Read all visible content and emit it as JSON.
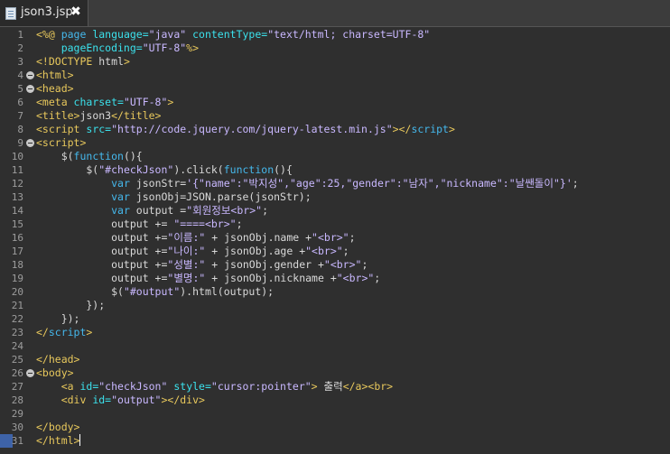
{
  "tab": {
    "title": "json3.jsp",
    "close": "✖"
  },
  "colors": {
    "tag": "#e8c85c",
    "attr": "#3be1ec",
    "string": "#c9b8ff",
    "keyword": "#45b8ec",
    "text": "#d9d9d9",
    "background": "#2f2f2f"
  },
  "lines": [
    {
      "n": "1",
      "fold": false,
      "segs": [
        [
          "<%@ ",
          "#e8c85c"
        ],
        [
          "page ",
          "#45b8ec"
        ],
        [
          "language=",
          "#3be1ec"
        ],
        [
          "\"java\"",
          "#c9b8ff"
        ],
        [
          " contentType=",
          "#3be1ec"
        ],
        [
          "\"text/html; charset=UTF-8\"",
          "#c9b8ff"
        ]
      ]
    },
    {
      "n": "2",
      "fold": false,
      "segs": [
        [
          "    pageEncoding=",
          "#3be1ec"
        ],
        [
          "\"UTF-8\"",
          "#c9b8ff"
        ],
        [
          "%>",
          "#e8c85c"
        ]
      ]
    },
    {
      "n": "3",
      "fold": false,
      "segs": [
        [
          "<!DOCTYPE ",
          "#e8c85c"
        ],
        [
          "html",
          "#d9d9d9"
        ],
        [
          ">",
          "#e8c85c"
        ]
      ]
    },
    {
      "n": "4",
      "fold": true,
      "segs": [
        [
          "<html>",
          "#e8c85c"
        ]
      ]
    },
    {
      "n": "5",
      "fold": true,
      "segs": [
        [
          "<head>",
          "#e8c85c"
        ]
      ]
    },
    {
      "n": "6",
      "fold": false,
      "segs": [
        [
          "<meta ",
          "#e8c85c"
        ],
        [
          "charset=",
          "#3be1ec"
        ],
        [
          "\"UTF-8\"",
          "#c9b8ff"
        ],
        [
          ">",
          "#e8c85c"
        ]
      ]
    },
    {
      "n": "7",
      "fold": false,
      "segs": [
        [
          "<title>",
          "#e8c85c"
        ],
        [
          "json3",
          "#d9d9d9"
        ],
        [
          "</title>",
          "#e8c85c"
        ]
      ]
    },
    {
      "n": "8",
      "fold": false,
      "segs": [
        [
          "<script ",
          "#e8c85c"
        ],
        [
          "src=",
          "#3be1ec"
        ],
        [
          "\"http://code.jquery.com/jquery-latest.min.js\"",
          "#c9b8ff"
        ],
        [
          "></",
          "#e8c85c"
        ],
        [
          "script",
          "#45b8ec"
        ],
        [
          ">",
          "#e8c85c"
        ]
      ]
    },
    {
      "n": "9",
      "fold": true,
      "segs": [
        [
          "<script>",
          "#e8c85c"
        ]
      ]
    },
    {
      "n": "10",
      "fold": false,
      "segs": [
        [
          "    $(",
          "#d9d9d9"
        ],
        [
          "function",
          "#45b8ec"
        ],
        [
          "(){",
          "#d9d9d9"
        ]
      ]
    },
    {
      "n": "11",
      "fold": false,
      "segs": [
        [
          "        $(",
          "#d9d9d9"
        ],
        [
          "\"#checkJson\"",
          "#c9b8ff"
        ],
        [
          ").click(",
          "#d9d9d9"
        ],
        [
          "function",
          "#45b8ec"
        ],
        [
          "(){",
          "#d9d9d9"
        ]
      ]
    },
    {
      "n": "12",
      "fold": false,
      "segs": [
        [
          "            ",
          "#d9d9d9"
        ],
        [
          "var ",
          "#45b8ec"
        ],
        [
          "jsonStr=",
          "#d9d9d9"
        ],
        [
          "'{\"name\":\"박지성\",\"age\":25,\"gender\":\"남자\",\"nickname\":\"날쌘돌이\"}'",
          "#c9b8ff"
        ],
        [
          ";",
          "#d9d9d9"
        ]
      ]
    },
    {
      "n": "13",
      "fold": false,
      "segs": [
        [
          "            ",
          "#d9d9d9"
        ],
        [
          "var ",
          "#45b8ec"
        ],
        [
          "jsonObj=JSON.parse(jsonStr);",
          "#d9d9d9"
        ]
      ]
    },
    {
      "n": "14",
      "fold": false,
      "segs": [
        [
          "            ",
          "#d9d9d9"
        ],
        [
          "var ",
          "#45b8ec"
        ],
        [
          "output =",
          "#d9d9d9"
        ],
        [
          "\"회원정보<br>\"",
          "#c9b8ff"
        ],
        [
          ";",
          "#d9d9d9"
        ]
      ]
    },
    {
      "n": "15",
      "fold": false,
      "segs": [
        [
          "            output += ",
          "#d9d9d9"
        ],
        [
          "\"====<br>\"",
          "#c9b8ff"
        ],
        [
          ";",
          "#d9d9d9"
        ]
      ]
    },
    {
      "n": "16",
      "fold": false,
      "segs": [
        [
          "            output +=",
          "#d9d9d9"
        ],
        [
          "\"이름:\"",
          "#c9b8ff"
        ],
        [
          " + jsonObj.name +",
          "#d9d9d9"
        ],
        [
          "\"<br>\"",
          "#c9b8ff"
        ],
        [
          ";",
          "#d9d9d9"
        ]
      ]
    },
    {
      "n": "17",
      "fold": false,
      "segs": [
        [
          "            output +=",
          "#d9d9d9"
        ],
        [
          "\"나이:\"",
          "#c9b8ff"
        ],
        [
          " + jsonObj.age +",
          "#d9d9d9"
        ],
        [
          "\"<br>\"",
          "#c9b8ff"
        ],
        [
          ";",
          "#d9d9d9"
        ]
      ]
    },
    {
      "n": "18",
      "fold": false,
      "segs": [
        [
          "            output +=",
          "#d9d9d9"
        ],
        [
          "\"성별:\"",
          "#c9b8ff"
        ],
        [
          " + jsonObj.gender +",
          "#d9d9d9"
        ],
        [
          "\"<br>\"",
          "#c9b8ff"
        ],
        [
          ";",
          "#d9d9d9"
        ]
      ]
    },
    {
      "n": "19",
      "fold": false,
      "segs": [
        [
          "            output +=",
          "#d9d9d9"
        ],
        [
          "\"별명:\"",
          "#c9b8ff"
        ],
        [
          " + jsonObj.nickname +",
          "#d9d9d9"
        ],
        [
          "\"<br>\"",
          "#c9b8ff"
        ],
        [
          ";",
          "#d9d9d9"
        ]
      ]
    },
    {
      "n": "20",
      "fold": false,
      "segs": [
        [
          "            $(",
          "#d9d9d9"
        ],
        [
          "\"#output\"",
          "#c9b8ff"
        ],
        [
          ").html(output);",
          "#d9d9d9"
        ]
      ]
    },
    {
      "n": "21",
      "fold": false,
      "segs": [
        [
          "        });",
          "#d9d9d9"
        ]
      ]
    },
    {
      "n": "22",
      "fold": false,
      "segs": [
        [
          "    });",
          "#d9d9d9"
        ]
      ]
    },
    {
      "n": "23",
      "fold": false,
      "segs": [
        [
          "</",
          "#e8c85c"
        ],
        [
          "script",
          "#45b8ec"
        ],
        [
          ">",
          "#e8c85c"
        ]
      ]
    },
    {
      "n": "24",
      "fold": false,
      "segs": []
    },
    {
      "n": "25",
      "fold": false,
      "segs": [
        [
          "</head>",
          "#e8c85c"
        ]
      ]
    },
    {
      "n": "26",
      "fold": true,
      "segs": [
        [
          "<body>",
          "#e8c85c"
        ]
      ]
    },
    {
      "n": "27",
      "fold": false,
      "segs": [
        [
          "    <a ",
          "#e8c85c"
        ],
        [
          "id=",
          "#3be1ec"
        ],
        [
          "\"checkJson\"",
          "#c9b8ff"
        ],
        [
          " style=",
          "#3be1ec"
        ],
        [
          "\"cursor:pointer\"",
          "#c9b8ff"
        ],
        [
          "> ",
          "#e8c85c"
        ],
        [
          "출력",
          "#d9d9d9"
        ],
        [
          "</a><br>",
          "#e8c85c"
        ]
      ]
    },
    {
      "n": "28",
      "fold": false,
      "segs": [
        [
          "    <div ",
          "#e8c85c"
        ],
        [
          "id=",
          "#3be1ec"
        ],
        [
          "\"output\"",
          "#c9b8ff"
        ],
        [
          "></div>",
          "#e8c85c"
        ]
      ]
    },
    {
      "n": "29",
      "fold": false,
      "segs": []
    },
    {
      "n": "30",
      "fold": false,
      "segs": [
        [
          "</body>",
          "#e8c85c"
        ]
      ]
    },
    {
      "n": "31",
      "fold": false,
      "segs": [
        [
          "</html>",
          "#e8c85c"
        ]
      ],
      "current": true
    }
  ]
}
